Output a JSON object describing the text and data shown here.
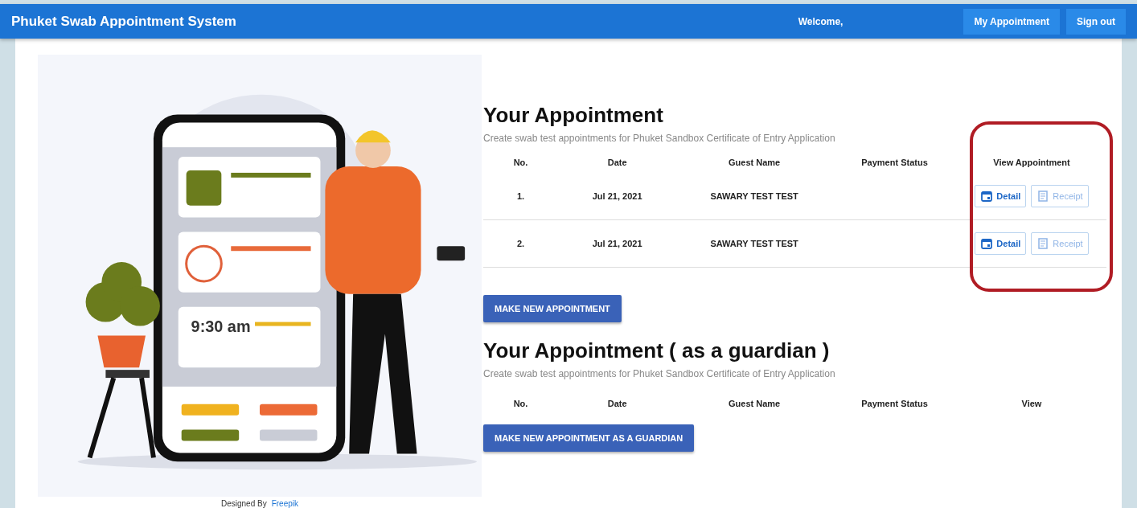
{
  "app_bar": {
    "title": "Phuket Swab Appointment System",
    "welcome": "Welcome,",
    "buttons": [
      "My Appointment",
      "Sign out"
    ]
  },
  "illustration": {
    "time": "9:30 am",
    "credit": "Designed By",
    "credit_link": "Freepik"
  },
  "appointments": {
    "title": "Your Appointment",
    "subtitle": "Create swab test appointments for Phuket Sandbox Certificate of Entry Application",
    "columns": [
      "No.",
      "Date",
      "Guest Name",
      "Payment Status",
      "View Appointment"
    ],
    "rows": [
      {
        "no": "1.",
        "date": "Jul 21, 2021",
        "guest": "SAWARY TEST TEST",
        "actions": [
          {
            "kind": "detail",
            "label": "Detail",
            "disabled": false
          },
          {
            "kind": "receipt",
            "label": "Receipt",
            "disabled": true
          }
        ]
      },
      {
        "no": "2.",
        "date": "Jul 21, 2021",
        "guest": "SAWARY TEST TEST",
        "actions": [
          {
            "kind": "detail",
            "label": "Detail",
            "disabled": false
          },
          {
            "kind": "receipt",
            "label": "Receipt",
            "disabled": true
          }
        ]
      }
    ],
    "button": "MAKE NEW APPOINTMENT"
  },
  "guardian": {
    "title": "Your Appointment ( as a guardian )",
    "subtitle": "Create swab test appointments for Phuket Sandbox Certificate of Entry Application",
    "columns": [
      "No.",
      "Date",
      "Guest Name",
      "Payment Status",
      "View"
    ],
    "button": "MAKE NEW APPOINTMENT AS A GUARDIAN"
  }
}
